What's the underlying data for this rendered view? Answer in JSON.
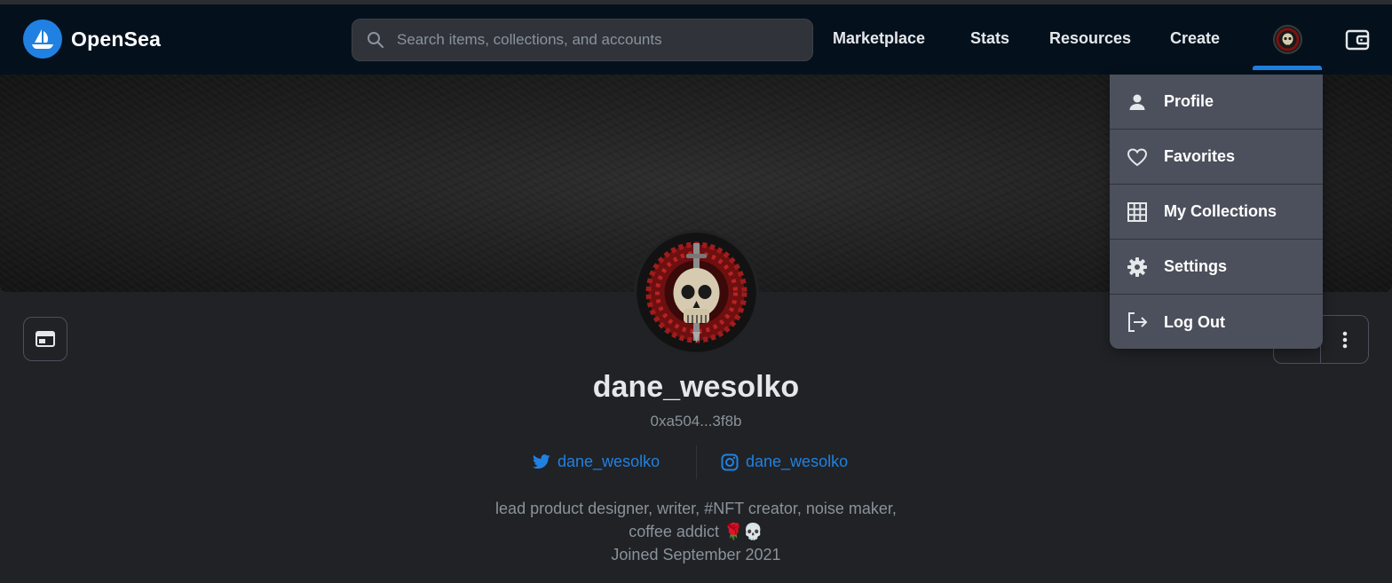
{
  "header": {
    "brand": "OpenSea",
    "search_placeholder": "Search items, collections, and accounts",
    "nav": {
      "marketplace": "Marketplace",
      "stats": "Stats",
      "resources": "Resources",
      "create": "Create"
    },
    "icons": {
      "logo": "opensea-logo-icon",
      "search": "search-icon",
      "avatar": "skull-avatar-icon",
      "wallet": "wallet-icon"
    },
    "accent_color": "#2081e2"
  },
  "dropdown": {
    "items": [
      {
        "label": "Profile",
        "icon": "person-icon"
      },
      {
        "label": "Favorites",
        "icon": "heart-icon"
      },
      {
        "label": "My Collections",
        "icon": "grid-icon"
      },
      {
        "label": "Settings",
        "icon": "gear-icon"
      },
      {
        "label": "Log Out",
        "icon": "logout-icon"
      }
    ]
  },
  "profile": {
    "username": "dane_wesolko",
    "address": "0xa504...3f8b",
    "twitter": "dane_wesolko",
    "instagram": "dane_wesolko",
    "bio_line1": "lead product designer, writer, #NFT creator, noise maker,",
    "bio_line2": "coffee addict 🌹💀",
    "joined": "Joined September 2021"
  }
}
